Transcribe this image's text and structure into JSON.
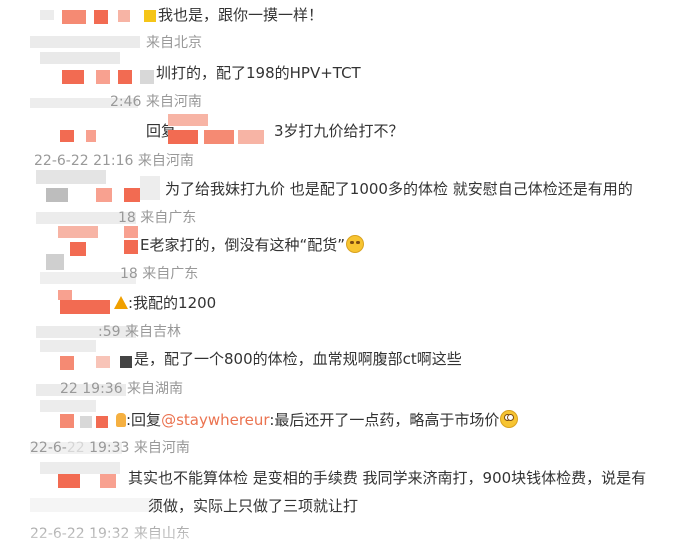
{
  "colors": {
    "mention": "#eb7350",
    "meta": "#999999",
    "text": "#333333",
    "pixel_red": "#f26b52",
    "pixel_gray": "#c7c7c7"
  },
  "comments": [
    {
      "text": "我也是，跟你一摸一样！",
      "meta": "22-6-22 22:24 来自北京"
    },
    {
      "text": "圳打的，配了198的HPV+TCT",
      "meta": "22-6-22 22:46 来自河南"
    },
    {
      "text_prefix": "回复",
      "text": "3岁打九价给打不？",
      "meta": "22-6-22 21:16 来自河南"
    },
    {
      "text": "为了给我妹打九价 也是配了1000多的体检 就安慰自己体检还是有用的",
      "meta": "22-6-22 21:18 来自广东"
    },
    {
      "text": "E老家打的，倒没有这种“配货”",
      "emoji": "laughing-tears-emoji",
      "meta": "22-6-22 20:18 来自广东"
    },
    {
      "text": ":我配的1200",
      "icon": "warning-icon",
      "meta": "22-6-22 19:59 来自吉林"
    },
    {
      "text": "是，配了一个800的体检，血常规啊腹部ct啊这些",
      "meta": "22-6-22 19:36 来自湖南"
    },
    {
      "reply_label": ":回复",
      "mention": "@staywhereur",
      "text": ":最后还开了一点药，略高于市场价",
      "emoji": "shocked-emoji",
      "meta": "22-6-22 19:33 来自河南"
    },
    {
      "text_line1": "其实也不能算体检 是变相的手续费 我同学来济南打，900块钱体检费，说是有",
      "text_line2": "八九项没做，实际上只做了三项就让打",
      "text_line2_visible": "须做，实际上只做了三项就让打",
      "meta": "22-6-22 19:32 来自山东"
    }
  ]
}
